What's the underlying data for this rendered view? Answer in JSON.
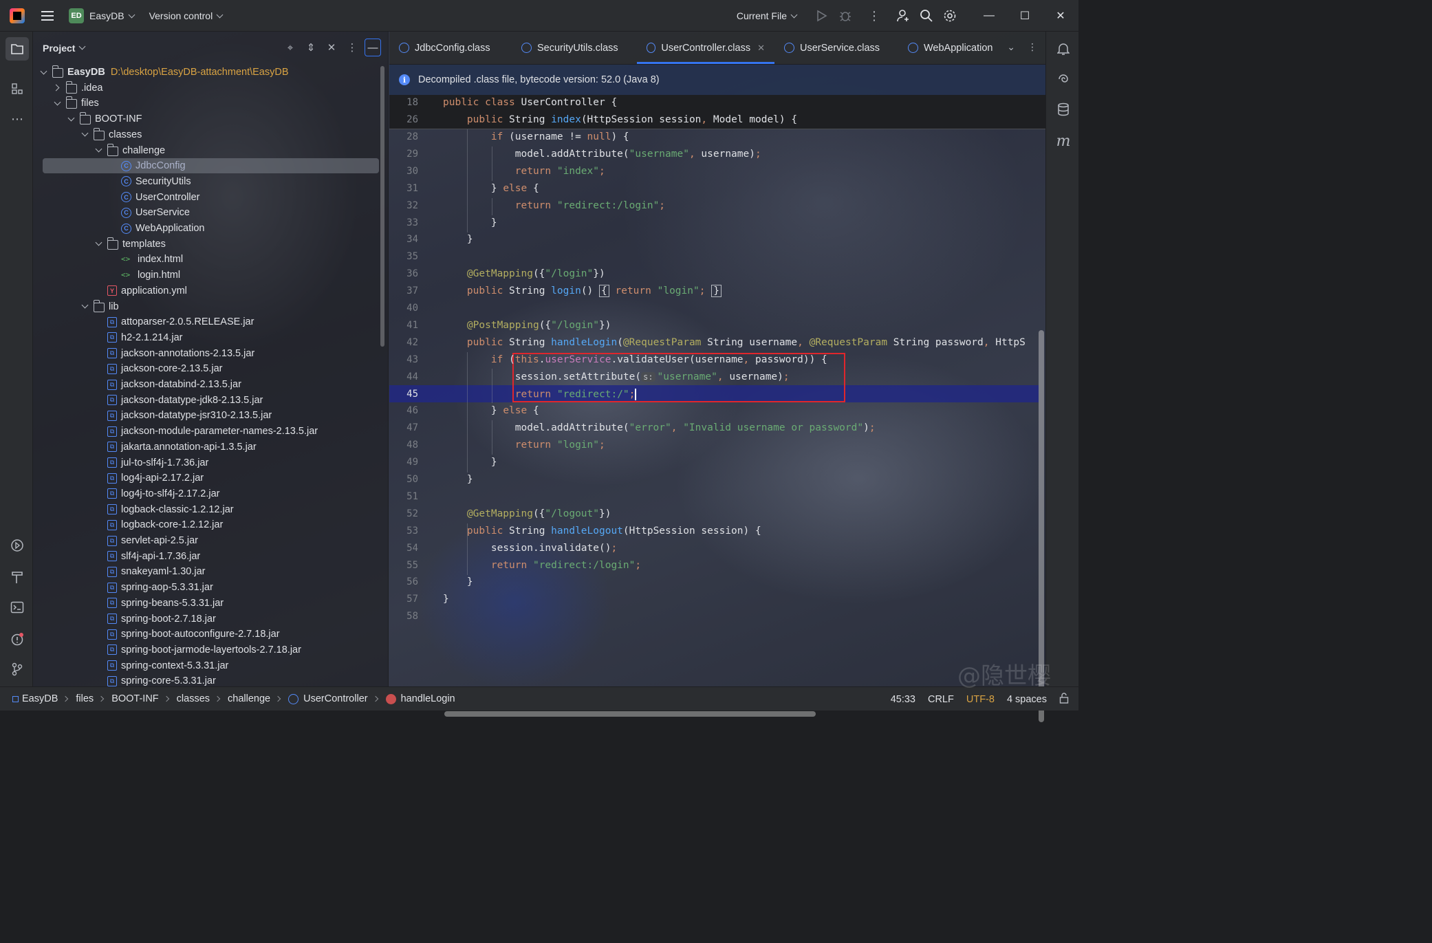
{
  "titlebar": {
    "project_badge": "ED",
    "project_name": "EasyDB",
    "vcs_label": "Version control",
    "run_config": "Current File"
  },
  "project_panel": {
    "title": "Project",
    "root_name": "EasyDB",
    "root_path": "D:\\desktop\\EasyDB-attachment\\EasyDB",
    "items": [
      {
        "label": "EasyDB",
        "depth": 0,
        "toggle": "open",
        "icon": "folder"
      },
      {
        "label": ".idea",
        "depth": 1,
        "toggle": "closed",
        "icon": "folder"
      },
      {
        "label": "files",
        "depth": 1,
        "toggle": "open",
        "icon": "folder"
      },
      {
        "label": "BOOT-INF",
        "depth": 2,
        "toggle": "open",
        "icon": "folder"
      },
      {
        "label": "classes",
        "depth": 3,
        "toggle": "open",
        "icon": "folder"
      },
      {
        "label": "challenge",
        "depth": 4,
        "toggle": "open",
        "icon": "folder"
      },
      {
        "label": "JdbcConfig",
        "depth": 5,
        "toggle": "none",
        "icon": "class",
        "selected": true
      },
      {
        "label": "SecurityUtils",
        "depth": 5,
        "toggle": "none",
        "icon": "class"
      },
      {
        "label": "UserController",
        "depth": 5,
        "toggle": "none",
        "icon": "class"
      },
      {
        "label": "UserService",
        "depth": 5,
        "toggle": "none",
        "icon": "class"
      },
      {
        "label": "WebApplication",
        "depth": 5,
        "toggle": "none",
        "icon": "class"
      },
      {
        "label": "templates",
        "depth": 4,
        "toggle": "open",
        "icon": "folder"
      },
      {
        "label": "index.html",
        "depth": 5,
        "toggle": "none",
        "icon": "html"
      },
      {
        "label": "login.html",
        "depth": 5,
        "toggle": "none",
        "icon": "html"
      },
      {
        "label": "application.yml",
        "depth": 4,
        "toggle": "none",
        "icon": "yml"
      },
      {
        "label": "lib",
        "depth": 3,
        "toggle": "open",
        "icon": "folder"
      },
      {
        "label": "attoparser-2.0.5.RELEASE.jar",
        "depth": 4,
        "toggle": "none",
        "icon": "jar"
      },
      {
        "label": "h2-2.1.214.jar",
        "depth": 4,
        "toggle": "none",
        "icon": "jar"
      },
      {
        "label": "jackson-annotations-2.13.5.jar",
        "depth": 4,
        "toggle": "none",
        "icon": "jar"
      },
      {
        "label": "jackson-core-2.13.5.jar",
        "depth": 4,
        "toggle": "none",
        "icon": "jar"
      },
      {
        "label": "jackson-databind-2.13.5.jar",
        "depth": 4,
        "toggle": "none",
        "icon": "jar"
      },
      {
        "label": "jackson-datatype-jdk8-2.13.5.jar",
        "depth": 4,
        "toggle": "none",
        "icon": "jar"
      },
      {
        "label": "jackson-datatype-jsr310-2.13.5.jar",
        "depth": 4,
        "toggle": "none",
        "icon": "jar"
      },
      {
        "label": "jackson-module-parameter-names-2.13.5.jar",
        "depth": 4,
        "toggle": "none",
        "icon": "jar"
      },
      {
        "label": "jakarta.annotation-api-1.3.5.jar",
        "depth": 4,
        "toggle": "none",
        "icon": "jar"
      },
      {
        "label": "jul-to-slf4j-1.7.36.jar",
        "depth": 4,
        "toggle": "none",
        "icon": "jar"
      },
      {
        "label": "log4j-api-2.17.2.jar",
        "depth": 4,
        "toggle": "none",
        "icon": "jar"
      },
      {
        "label": "log4j-to-slf4j-2.17.2.jar",
        "depth": 4,
        "toggle": "none",
        "icon": "jar"
      },
      {
        "label": "logback-classic-1.2.12.jar",
        "depth": 4,
        "toggle": "none",
        "icon": "jar"
      },
      {
        "label": "logback-core-1.2.12.jar",
        "depth": 4,
        "toggle": "none",
        "icon": "jar"
      },
      {
        "label": "servlet-api-2.5.jar",
        "depth": 4,
        "toggle": "none",
        "icon": "jar"
      },
      {
        "label": "slf4j-api-1.7.36.jar",
        "depth": 4,
        "toggle": "none",
        "icon": "jar"
      },
      {
        "label": "snakeyaml-1.30.jar",
        "depth": 4,
        "toggle": "none",
        "icon": "jar"
      },
      {
        "label": "spring-aop-5.3.31.jar",
        "depth": 4,
        "toggle": "none",
        "icon": "jar"
      },
      {
        "label": "spring-beans-5.3.31.jar",
        "depth": 4,
        "toggle": "none",
        "icon": "jar"
      },
      {
        "label": "spring-boot-2.7.18.jar",
        "depth": 4,
        "toggle": "none",
        "icon": "jar"
      },
      {
        "label": "spring-boot-autoconfigure-2.7.18.jar",
        "depth": 4,
        "toggle": "none",
        "icon": "jar"
      },
      {
        "label": "spring-boot-jarmode-layertools-2.7.18.jar",
        "depth": 4,
        "toggle": "none",
        "icon": "jar"
      },
      {
        "label": "spring-context-5.3.31.jar",
        "depth": 4,
        "toggle": "none",
        "icon": "jar"
      },
      {
        "label": "spring-core-5.3.31.jar",
        "depth": 4,
        "toggle": "none",
        "icon": "jar"
      }
    ]
  },
  "tabs": [
    {
      "label": "JdbcConfig.class",
      "active": false
    },
    {
      "label": "SecurityUtils.class",
      "active": false
    },
    {
      "label": "UserController.class",
      "active": true
    },
    {
      "label": "UserService.class",
      "active": false
    },
    {
      "label": "WebApplication",
      "active": false
    }
  ],
  "banner": "Decompiled .class file, bytecode version: 52.0 (Java 8)",
  "code": {
    "sticky": [
      {
        "n": "18",
        "html": "<span class=\"kw\">public class</span> UserController {"
      },
      {
        "n": "26",
        "html": "    <span class=\"kw\">public</span> String <span class=\"fn\">index</span>(HttpSession session<span class=\"kw\">,</span> Model model) {"
      }
    ],
    "current_line": "45",
    "lines": [
      {
        "n": "28",
        "html": "        <span class=\"kw\">if</span> (username != <span class=\"kw\">null</span>) {"
      },
      {
        "n": "29",
        "html": "            model.addAttribute(<span class=\"str\">\"username\"</span><span class=\"kw\">,</span> username)<span class=\"kw\">;</span>"
      },
      {
        "n": "30",
        "html": "            <span class=\"kw\">return</span> <span class=\"str\">\"index\"</span><span class=\"kw\">;</span>"
      },
      {
        "n": "31",
        "html": "        } <span class=\"kw\">else</span> {"
      },
      {
        "n": "32",
        "html": "            <span class=\"kw\">return</span> <span class=\"str\">\"redirect:/login\"</span><span class=\"kw\">;</span>"
      },
      {
        "n": "33",
        "html": "        }"
      },
      {
        "n": "34",
        "html": "    }"
      },
      {
        "n": "35",
        "html": ""
      },
      {
        "n": "36",
        "html": "    <span class=\"ann\">@GetMapping</span>({<span class=\"str\">\"/login\"</span>})"
      },
      {
        "n": "37",
        "html": "    <span class=\"kw\">public</span> String <span class=\"fn\">login</span>() <span style=\"border:1px solid #b4b8bf;padding:0 2px\">{</span> <span class=\"kw\">return</span> <span class=\"str\">\"login\"</span><span class=\"kw\">;</span> <span style=\"border:1px solid #b4b8bf;padding:0 2px\">}</span>"
      },
      {
        "n": "40",
        "html": ""
      },
      {
        "n": "41",
        "html": "    <span class=\"ann\">@PostMapping</span>({<span class=\"str\">\"/login\"</span>})"
      },
      {
        "n": "42",
        "html": "    <span class=\"kw\">public</span> String <span class=\"fn\">handleLogin</span>(<span class=\"ann\">@RequestParam</span> String username<span class=\"kw\">,</span> <span class=\"ann\">@RequestParam</span> String password<span class=\"kw\">,</span> HttpS"
      },
      {
        "n": "43",
        "html": "        <span class=\"kw\">if</span> (<span class=\"kw\">this</span>.<span class=\"fld\">userService</span>.validateUser(username<span class=\"kw\">,</span> password)) {"
      },
      {
        "n": "44",
        "html": "            session.setAttribute(<span class=\"inlay\">s:</span><span class=\"str\">\"username\"</span><span class=\"kw\">,</span> username)<span class=\"kw\">;</span>"
      },
      {
        "n": "45",
        "html": "            <span class=\"kw\">return</span> <span class=\"str\">\"redirect:/\"</span><span class=\"kw\">;</span><span class=\"caret\"></span>"
      },
      {
        "n": "46",
        "html": "        } <span class=\"kw\">else</span> {"
      },
      {
        "n": "47",
        "html": "            model.addAttribute(<span class=\"str\">\"error\"</span><span class=\"kw\">,</span> <span class=\"str\">\"Invalid username or password\"</span>)<span class=\"kw\">;</span>"
      },
      {
        "n": "48",
        "html": "            <span class=\"kw\">return</span> <span class=\"str\">\"login\"</span><span class=\"kw\">;</span>"
      },
      {
        "n": "49",
        "html": "        }"
      },
      {
        "n": "50",
        "html": "    }"
      },
      {
        "n": "51",
        "html": ""
      },
      {
        "n": "52",
        "html": "    <span class=\"ann\">@GetMapping</span>({<span class=\"str\">\"/logout\"</span>})"
      },
      {
        "n": "53",
        "html": "    <span class=\"kw\">public</span> String <span class=\"fn\">handleLogout</span>(HttpSession session) {"
      },
      {
        "n": "54",
        "html": "        session.invalidate()<span class=\"kw\">;</span>"
      },
      {
        "n": "55",
        "html": "        <span class=\"kw\">return</span> <span class=\"str\">\"redirect:/login\"</span><span class=\"kw\">;</span>"
      },
      {
        "n": "56",
        "html": "    }"
      },
      {
        "n": "57",
        "html": "}"
      },
      {
        "n": "58",
        "html": ""
      }
    ]
  },
  "statusbar": {
    "breadcrumb": [
      "EasyDB",
      "files",
      "BOOT-INF",
      "classes",
      "challenge",
      "UserController",
      "handleLogin"
    ],
    "position": "45:33",
    "line_sep": "CRLF",
    "encoding": "UTF-8",
    "indent": "4 spaces"
  },
  "watermark": "@隐世樱"
}
